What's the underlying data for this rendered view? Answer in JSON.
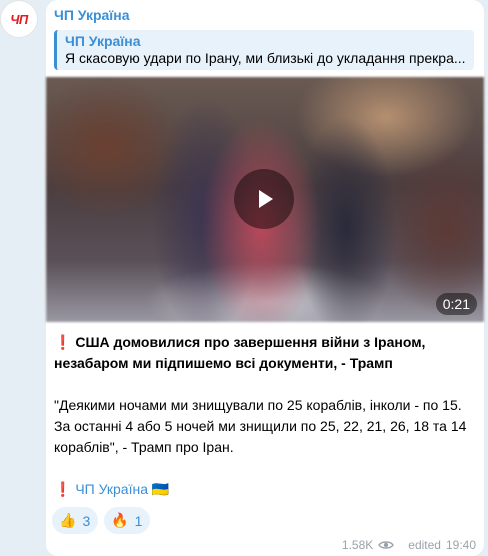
{
  "channel": {
    "name": "ЧП Україна",
    "avatar_text": "ЧП"
  },
  "reply": {
    "title": "ЧП Україна",
    "text": "Я скасовую удари по Ірану, ми близькі до укладання прекра..."
  },
  "video": {
    "duration": "0:21"
  },
  "message": {
    "headline_icon": "❗",
    "headline": "США домовилися про завершення війни з Іраном, незабаром ми підпишемо всі документи, - Трамп",
    "quote": "\"Деякими ночами ми знищували по 25 кораблів, інколи - по 15. За останні 4 або 5 ночей ми знищили по 25, 22, 21, 26, 18 та 14 кораблів\", - Трамп про Іран.",
    "signature_icon": "❗",
    "signature_link": "ЧП Україна",
    "signature_flag": "🇺🇦"
  },
  "reactions": [
    {
      "emoji": "👍",
      "count": "3"
    },
    {
      "emoji": "🔥",
      "count": "1"
    }
  ],
  "meta": {
    "views": "1.58K",
    "edited_label": "edited",
    "time": "19:40"
  }
}
